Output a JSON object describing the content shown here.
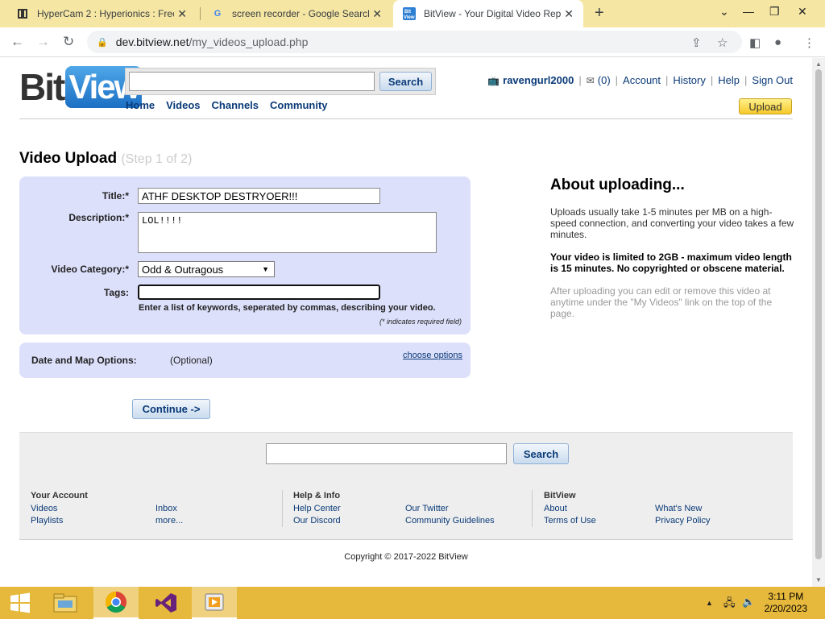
{
  "browser": {
    "tabs": [
      {
        "title": "HyperCam 2 : Hyperionics : Free",
        "favicon": "film-strip-icon"
      },
      {
        "title": "screen recorder - Google Search",
        "favicon": "google-icon"
      },
      {
        "title": "BitView - Your Digital Video Repo",
        "favicon": "bitview-icon"
      }
    ],
    "url_host": "dev.bitview.net",
    "url_path": "/my_videos_upload.php"
  },
  "header": {
    "logo_bit": "Bit",
    "logo_view": "View",
    "search_button": "Search",
    "nav": [
      "Home",
      "Videos",
      "Channels",
      "Community"
    ],
    "username": "ravengurl2000",
    "inbox_count": "(0)",
    "links": [
      "Account",
      "History",
      "Help",
      "Sign Out"
    ],
    "upload_button": "Upload"
  },
  "upload": {
    "title": "Video Upload",
    "step": "(Step 1 of 2)",
    "title_label": "Title:*",
    "title_value": "ATHF DESKTOP DESTRYOER!!!",
    "description_label": "Description:*",
    "description_value": "LOL!!!!",
    "category_label": "Video Category:*",
    "category_value": "Odd & Outragous",
    "tags_label": "Tags:",
    "tags_value": "",
    "tags_hint": "Enter a list of keywords, seperated by commas, describing your video.",
    "required_note": "(* indicates required field)",
    "date_map_label": "Date and Map Options:",
    "date_map_optional": "(Optional)",
    "choose_options": "choose options",
    "continue_button": "Continue ->"
  },
  "about": {
    "title": "About uploading...",
    "p1": "Uploads usually take 1-5 minutes per MB on a high-speed connection, and converting your video takes a few minutes.",
    "p2": "Your video is limited to 2GB - maximum video length is 15 minutes. No copyrighted or obscene material.",
    "p3": "After uploading you can edit or remove this video at anytime under the \"My Videos\" link on the top of the page."
  },
  "footer": {
    "search_button": "Search",
    "your_account": {
      "heading": "Your Account",
      "col1": [
        "Videos",
        "Playlists"
      ],
      "col2": [
        "Inbox",
        "more..."
      ]
    },
    "help_info": {
      "heading": "Help & Info",
      "col1": [
        "Help Center",
        "Our Discord"
      ],
      "col2": [
        "Our Twitter",
        "Community Guidelines"
      ]
    },
    "bitview": {
      "heading": "BitView",
      "col1": [
        "About",
        "Terms of Use"
      ],
      "col2": [
        "What's New",
        "Privacy Policy"
      ]
    },
    "copyright": "Copyright © 2017-2022 BitView"
  },
  "taskbar": {
    "time": "3:11 PM",
    "date": "2/20/2023",
    "apps": [
      "file-explorer-icon",
      "chrome-icon",
      "visual-studio-icon",
      "hypercam-icon"
    ]
  },
  "colors": {
    "link": "#0a3a78",
    "form_bg": "#dde0fb",
    "taskbar": "#e6b83c",
    "tabstrip": "#f5e6a3"
  }
}
